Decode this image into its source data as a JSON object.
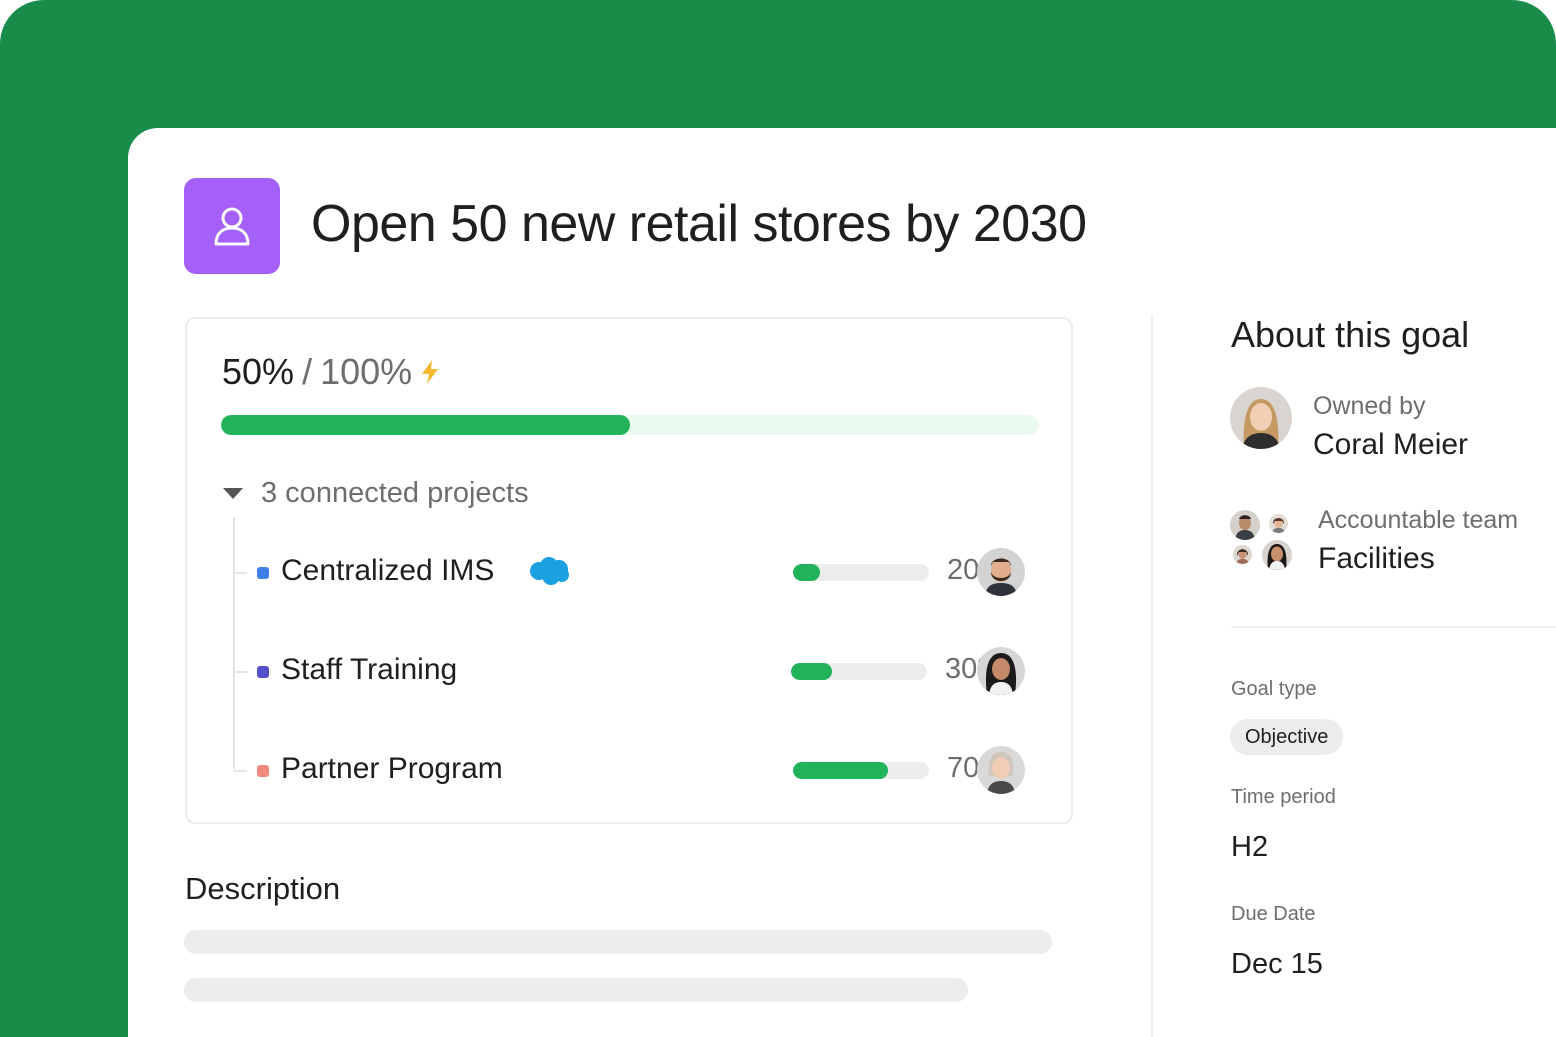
{
  "colors": {
    "brand_green": "#188c48",
    "goal_icon_bg": "#a55ffa",
    "progress_green": "#20b35a",
    "progress_track": "#e9fbef",
    "bolt": "#f5b82e",
    "salesforce_blue": "#1ba0e2"
  },
  "goal": {
    "icon": "person-goal-icon",
    "title": "Open 50 new retail stores by 2030"
  },
  "progress": {
    "current": "50%",
    "separator": "/",
    "target": "100%",
    "fraction": 0.5,
    "icon": "lightning-bolt-icon"
  },
  "connected": {
    "label": "3 connected projects",
    "projects": [
      {
        "name": "Centralized IMS",
        "integration": "salesforce-cloud-icon",
        "dot_color": "#3e7fe8",
        "percent_label": "20%",
        "fraction": 0.2,
        "avatar": "male-avatar-beard"
      },
      {
        "name": "Staff Training",
        "integration": null,
        "dot_color": "#5551c9",
        "percent_label": "30%",
        "fraction": 0.3,
        "avatar": "female-avatar-dark-hair"
      },
      {
        "name": "Partner Program",
        "integration": null,
        "dot_color": "#ee8b7c",
        "percent_label": "70%",
        "fraction": 0.7,
        "avatar": "female-avatar-gray-hair"
      }
    ]
  },
  "description": {
    "title": "Description"
  },
  "about": {
    "title": "About this goal",
    "owner": {
      "label": "Owned by",
      "name": "Coral Meier"
    },
    "team": {
      "label": "Accountable team",
      "name": "Facilities"
    },
    "goal_type": {
      "label": "Goal type",
      "value": "Objective"
    },
    "time_period": {
      "label": "Time period",
      "value": "H2"
    },
    "due_date": {
      "label": "Due Date",
      "value": "Dec 15"
    }
  }
}
